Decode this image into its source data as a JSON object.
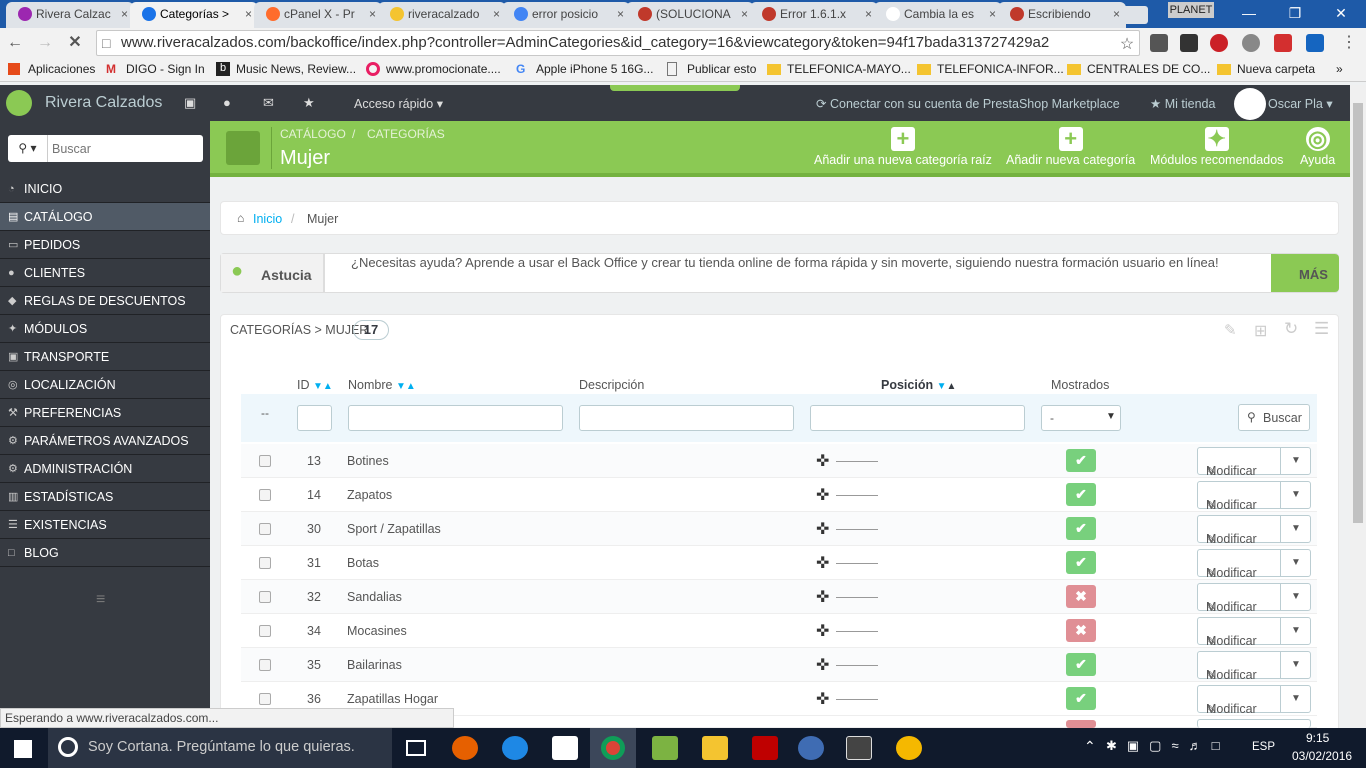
{
  "browser": {
    "tabs": [
      {
        "label": "Rivera Calzac",
        "active": false
      },
      {
        "label": "Categorías >",
        "active": true
      },
      {
        "label": "cPanel X - Pr",
        "active": false
      },
      {
        "label": "riveracalzado",
        "active": false
      },
      {
        "label": "error posicio",
        "active": false
      },
      {
        "label": "(SOLUCIONA",
        "active": false
      },
      {
        "label": "Error 1.6.1.x",
        "active": false
      },
      {
        "label": "Cambia la es",
        "active": false
      },
      {
        "label": "Escribiendo",
        "active": false
      }
    ],
    "user_label": "PLANET",
    "url": "www.riveracalzados.com/backoffice/index.php?controller=AdminCategories&id_category=16&viewcategory&token=94f17bada313727429a2",
    "bookmarks": [
      "Aplicaciones",
      "DIGO - Sign In",
      "Music News, Review...",
      "www.promocionate....",
      "Apple iPhone 5 16G...",
      "Publicar esto",
      "TELEFONICA-MAYO...",
      "TELEFONICA-INFOR...",
      "CENTRALES DE CO...",
      "Nueva carpeta"
    ]
  },
  "header": {
    "shop_name": "Rivera Calzados",
    "quick_access": "Acceso rápido",
    "marketplace": "Conectar con su cuenta de PrestaShop Marketplace",
    "my_shop": "Mi tienda",
    "user": "Oscar Pla"
  },
  "sidebar": {
    "search_placeholder": "Buscar",
    "items": [
      {
        "label": "INICIO",
        "icon": "speedometer-icon"
      },
      {
        "label": "CATÁLOGO",
        "icon": "book-icon",
        "active": true
      },
      {
        "label": "PEDIDOS",
        "icon": "credit-card-icon"
      },
      {
        "label": "CLIENTES",
        "icon": "users-icon"
      },
      {
        "label": "REGLAS DE DESCUENTOS",
        "icon": "tag-icon"
      },
      {
        "label": "MÓDULOS",
        "icon": "puzzle-icon"
      },
      {
        "label": "TRANSPORTE",
        "icon": "truck-icon"
      },
      {
        "label": "LOCALIZACIÓN",
        "icon": "globe-icon"
      },
      {
        "label": "PREFERENCIAS",
        "icon": "wrench-icon"
      },
      {
        "label": "PARÁMETROS AVANZADOS",
        "icon": "cogs-icon"
      },
      {
        "label": "ADMINISTRACIÓN",
        "icon": "cog-icon"
      },
      {
        "label": "ESTADÍSTICAS",
        "icon": "chart-icon"
      },
      {
        "label": "EXISTENCIAS",
        "icon": "list-icon"
      },
      {
        "label": "BLOG",
        "icon": "file-icon"
      }
    ]
  },
  "toolbar": {
    "breadcrumb_1": "CATÁLOGO",
    "breadcrumb_2": "CATEGORÍAS",
    "title": "Mujer",
    "buttons": [
      "Añadir una nueva categoría raíz",
      "Añadir nueva categoría",
      "Módulos recomendados",
      "Ayuda"
    ]
  },
  "path": {
    "home": "Inicio",
    "current": "Mujer"
  },
  "tip": {
    "label": "Astucia",
    "text": "¿Necesitas ayuda? Aprende a usar el Back Office y crear tu tienda online de forma rápida y sin moverte, siguiendo nuestra formación usuario en línea!",
    "more": "MÁS"
  },
  "list": {
    "title": "CATEGORÍAS > MUJER",
    "count": "17",
    "columns": {
      "id": "ID",
      "name": "Nombre",
      "description": "Descripción",
      "position": "Posición",
      "shown": "Mostrados"
    },
    "filter_dash": "--",
    "select_value": "-",
    "search_button": "Buscar",
    "edit_label": "Modificar",
    "rows": [
      {
        "id": "13",
        "name": "Botines",
        "shown": true
      },
      {
        "id": "14",
        "name": "Zapatos",
        "shown": true
      },
      {
        "id": "30",
        "name": "Sport / Zapatillas",
        "shown": true
      },
      {
        "id": "31",
        "name": "Botas",
        "shown": true
      },
      {
        "id": "32",
        "name": "Sandalias",
        "shown": false
      },
      {
        "id": "34",
        "name": "Mocasines",
        "shown": false
      },
      {
        "id": "35",
        "name": "Bailarinas",
        "shown": true
      },
      {
        "id": "36",
        "name": "Zapatillas Hogar",
        "shown": true
      }
    ]
  },
  "status_bar": "Esperando a www.riveracalzados.com...",
  "taskbar": {
    "search_text": "Soy Cortana. Pregúntame lo que quieras.",
    "lang": "ESP",
    "time": "9:15",
    "date": "03/02/2016"
  }
}
